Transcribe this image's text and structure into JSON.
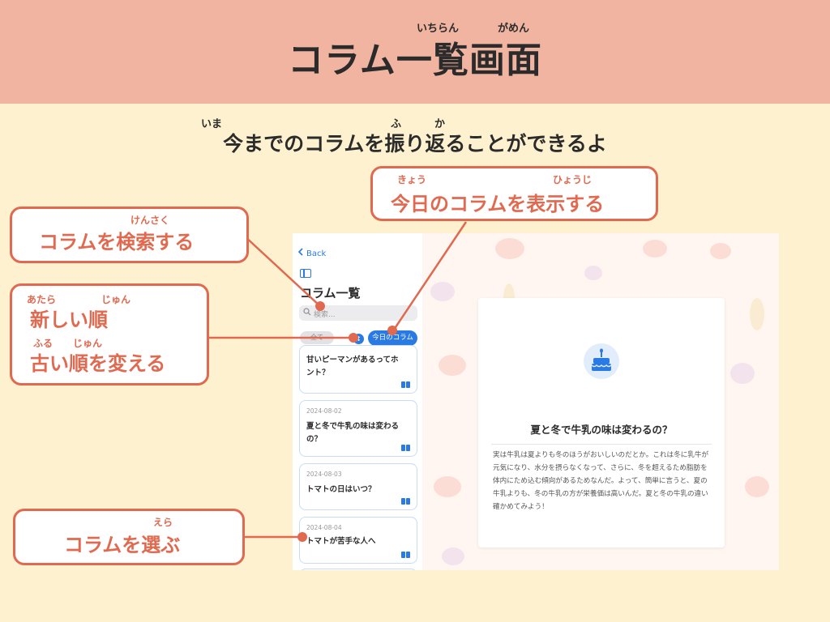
{
  "header": {
    "title": "コラム一覧画面",
    "ruby_ichiran": "いちらん",
    "ruby_gamen": "がめん"
  },
  "subtitle": {
    "text": "今までのコラムを振り返ることができるよ",
    "ruby_ima": "いま",
    "ruby_fu": "ふ",
    "ruby_ka": "か"
  },
  "callouts": {
    "today": {
      "text": "今日のコラムを表示する",
      "ruby_kyou": "きょう",
      "ruby_hyouji": "ひょうじ"
    },
    "search": {
      "text": "コラムを検索する",
      "ruby_kensaku": "けんさく"
    },
    "sort": {
      "line1": "新しい順",
      "line2": "古い順を変える",
      "ruby_atara": "あたら",
      "ruby_jun1": "じゅん",
      "ruby_furu": "ふる",
      "ruby_jun2": "じゅん"
    },
    "select": {
      "text": "コラムを選ぶ",
      "ruby_era": "えら"
    }
  },
  "app": {
    "back_label": "Back",
    "list_title": "コラム一覧",
    "search_placeholder": "検索...",
    "filter_all": "全て",
    "filter_today": "今日のコラム",
    "columns": [
      {
        "date": "",
        "title": "甘いピーマンがあるってホント？"
      },
      {
        "date": "2024-08-02",
        "title": "夏と冬で牛乳の味は変わるの？"
      },
      {
        "date": "2024-08-03",
        "title": "トマトの日はいつ？"
      },
      {
        "date": "2024-08-04",
        "title": "トマトが苦手な人へ"
      }
    ],
    "detail": {
      "icon": "cake-icon",
      "title": "夏と冬で牛乳の味は変わるの？",
      "body": "実は牛乳は夏よりも冬のほうがおいしいのだとか。これは冬に乳牛が元気になり、水分を摂らなくなって、さらに、冬を超えるため脂肪を体内にため込む傾向があるためなんだ。よって、簡単に言うと、夏の牛乳よりも、冬の牛乳の方が栄養価は高いんだ。夏と冬の牛乳の違い確かめてみよう！"
    }
  },
  "colors": {
    "accent": "#e0694f",
    "header_bg": "#f0b4a0",
    "page_bg": "#fdf1cf",
    "app_blue": "#2a7ae4"
  }
}
